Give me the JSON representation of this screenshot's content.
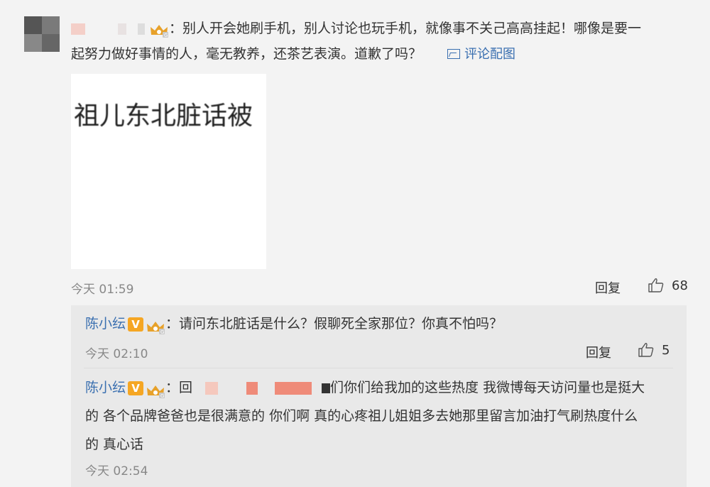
{
  "main_comment": {
    "name_fragment": "",
    "text_line1": "：别人开会她刷手机，别人讨论也玩手机，就像事不关己高高挂起！哪像是要一",
    "text_line2": "起努力做好事情的人，毫无教养，还茶艺表演。道歉了吗？",
    "pic_link": "评论配图",
    "image_text": "祖儿东北脏话被",
    "time": "今天 01:59",
    "reply_label": "回复",
    "likes": "68"
  },
  "replies": [
    {
      "username": "陈小纭",
      "vip_badge": "V",
      "text": "：请问东北脏话是什么？假聊死全家那位？你真不怕吗？",
      "time": "今天 02:10",
      "reply_label": "回复",
      "likes": "5"
    },
    {
      "username": "陈小纭",
      "vip_badge": "V",
      "text_prefix": "：回",
      "text_line1_rest": "们你们给我加的这些热度 我微博每天访问量也是挺大",
      "text_line2": "的 各个品牌爸爸也是很满意的 你们啊 真的心疼祖儿姐姐多去她那里留言加油打气刷热度什么",
      "text_line3": "的 真心话",
      "time": "今天 02:54"
    }
  ],
  "colors": {
    "link_blue": "#3a6fb0",
    "vip_orange": "#f5a623",
    "background": "#f3f3f3",
    "reply_bg": "#e9e9e9"
  },
  "icons": {
    "crown": "crown-badge-icon",
    "like": "thumbs-up-icon",
    "picture": "picture-icon"
  }
}
